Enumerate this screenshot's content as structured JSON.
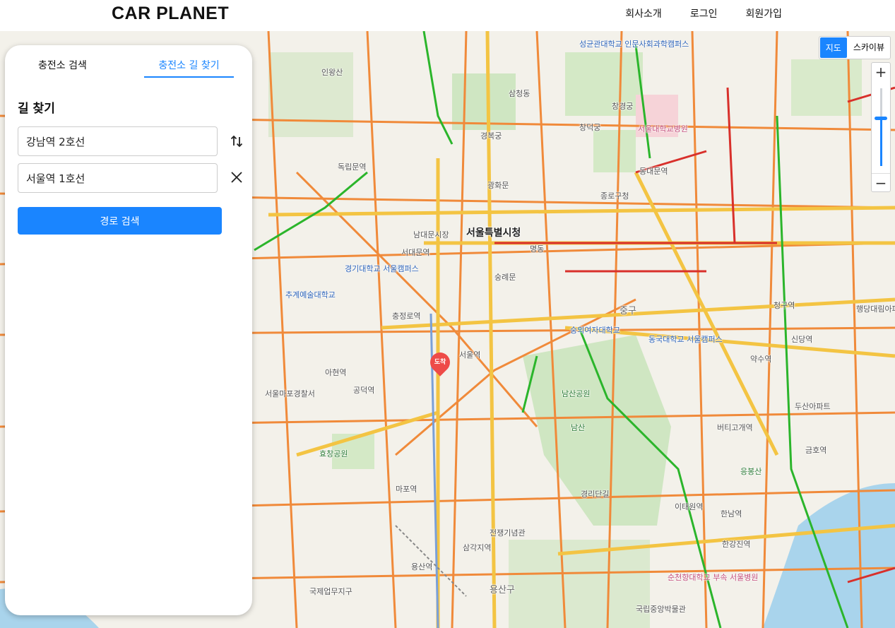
{
  "header": {
    "logo": "CAR PLANET",
    "nav": [
      "회사소개",
      "로그인",
      "회원가입"
    ]
  },
  "panel": {
    "tabs": [
      "충전소 검색",
      "충전소 길 찾기"
    ],
    "active_tab": "충전소 길 찾기",
    "section_title": "길 찾기",
    "origin_value": "강남역 2호선",
    "destination_value": "서울역 1호선",
    "search_button": "경로 검색",
    "swap_icon": "swap-vertical-icon",
    "clear_icon": "close-icon"
  },
  "map": {
    "type_buttons": [
      "지도",
      "스카이뷰"
    ],
    "active_type": "지도",
    "zoom_in": "+",
    "zoom_out": "−",
    "marker_label": "도착",
    "labels": [
      "서울특별시청",
      "숭례문",
      "서울역",
      "남산공원",
      "남산",
      "용산구",
      "중구",
      "종로구청",
      "서울대학교병원",
      "성균관대학교 인문사회과학캠퍼스",
      "경복궁",
      "창덕궁",
      "창경궁",
      "동대문역",
      "약수역",
      "한강진역",
      "경기대학교 서울캠퍼스",
      "추계예술대학교",
      "숭의여자대학교",
      "동국대학교 서울캠퍼스",
      "국립중앙박물관",
      "효창공원",
      "전쟁기념관",
      "삼각지역",
      "경리단길",
      "이태원역",
      "인왕산",
      "독립문역",
      "마포역",
      "신당역",
      "청구역",
      "버티고개역",
      "한남역",
      "삼청동",
      "명동",
      "광화문",
      "남대문시장",
      "순천향대학교 부속 서울병원",
      "용산역",
      "국제업무지구",
      "서울마포경찰서",
      "금호역",
      "응봉산",
      "두산아파트",
      "행당대림아파트",
      "서대문역",
      "충정로역",
      "아현역",
      "공덕역"
    ],
    "colors": {
      "road_major": "#f3c443",
      "road_arterial": "#f08a3a",
      "traffic_red": "#d8302b",
      "traffic_green": "#2bb52b",
      "park": "#cfe6c2",
      "water": "#a9d4ec",
      "accent": "#1a85ff"
    }
  }
}
